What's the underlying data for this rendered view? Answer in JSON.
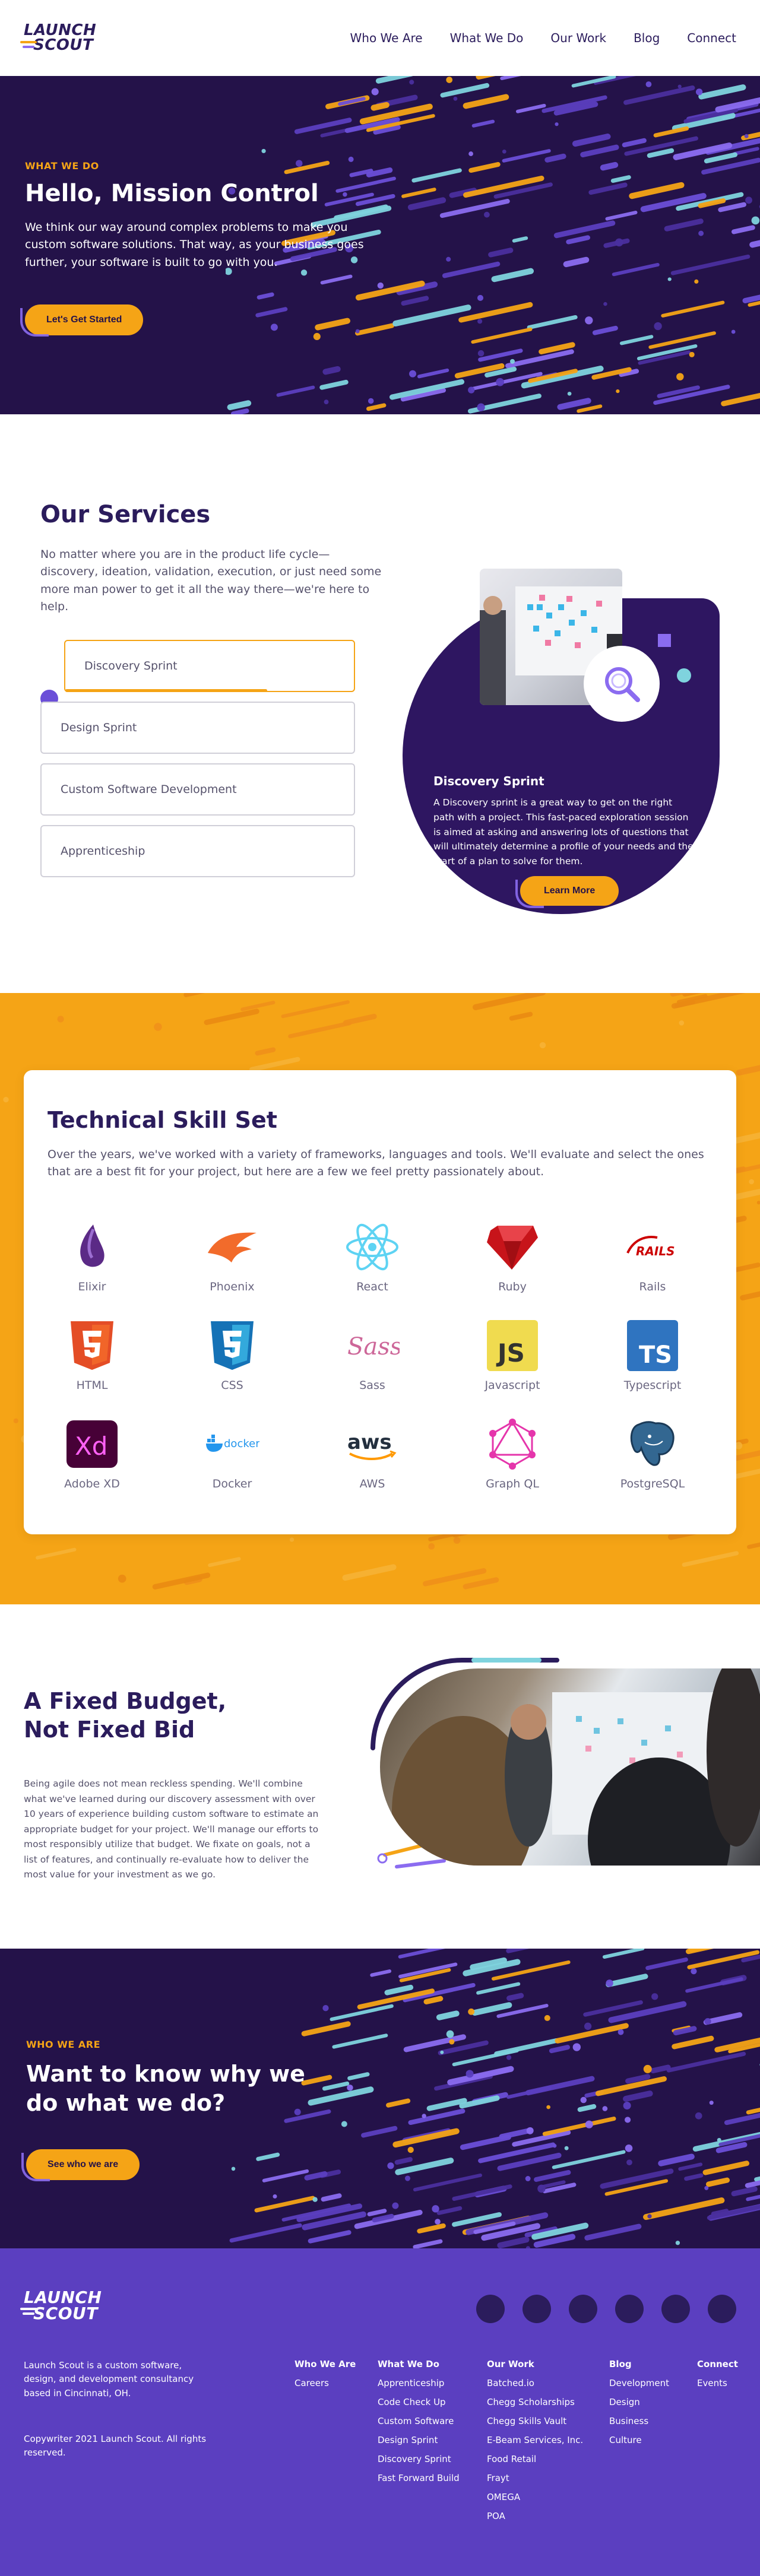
{
  "nav": {
    "logo_line1": "LAUNCH",
    "logo_line2": "SCOUT",
    "links": [
      "Who We Are",
      "What We Do",
      "Our Work",
      "Blog",
      "Connect"
    ]
  },
  "hero": {
    "eyebrow": "WHAT WE DO",
    "title": "Hello, Mission Control",
    "body": "We think our way around complex problems to make you custom software solutions. That way, as your business goes further, your software is built to go with you.",
    "cta": "Let's Get Started"
  },
  "services": {
    "title": "Our Services",
    "lead": "No matter where you are in the product life cycle—discovery, ideation, validation, execution, or just need some more man power to get it all the way there—we're here to help.",
    "items": [
      "Discovery Sprint",
      "Design Sprint",
      "Custom Software Development",
      "Apprenticeship"
    ],
    "active_index": 0,
    "card": {
      "title": "Discovery Sprint",
      "body": "A Discovery sprint is a great way to get on the right path with a project. This fast-paced exploration session is aimed at asking and answering lots of questions that will ultimately determine a profile of your needs and the start of a plan to solve for them.",
      "cta": "Learn More"
    }
  },
  "skills": {
    "title": "Technical Skill Set",
    "lead": "Over the years, we've worked with a variety of frameworks, languages and tools. We'll evaluate and select the ones that are a best fit for your project, but here are a few we feel pretty passionately about.",
    "items": [
      {
        "name": "Elixir",
        "icon": "elixir-icon"
      },
      {
        "name": "Phoenix",
        "icon": "phoenix-icon"
      },
      {
        "name": "React",
        "icon": "react-icon"
      },
      {
        "name": "Ruby",
        "icon": "ruby-icon"
      },
      {
        "name": "Rails",
        "icon": "rails-icon"
      },
      {
        "name": "HTML",
        "icon": "html5-icon"
      },
      {
        "name": "CSS",
        "icon": "css3-icon"
      },
      {
        "name": "Sass",
        "icon": "sass-icon"
      },
      {
        "name": "Javascript",
        "icon": "javascript-icon"
      },
      {
        "name": "Typescript",
        "icon": "typescript-icon"
      },
      {
        "name": "Adobe XD",
        "icon": "adobe-xd-icon"
      },
      {
        "name": "Docker",
        "icon": "docker-icon"
      },
      {
        "name": "AWS",
        "icon": "aws-icon"
      },
      {
        "name": "Graph QL",
        "icon": "graphql-icon"
      },
      {
        "name": "PostgreSQL",
        "icon": "postgresql-icon"
      }
    ],
    "icon_text": {
      "rails": "RAILS",
      "js": "JS",
      "ts": "TS",
      "xd": "Xd",
      "docker": "docker",
      "aws": "aws",
      "sass": "Sass"
    }
  },
  "budget": {
    "title": "A Fixed Budget, Not Fixed Bid",
    "body": "Being agile does not mean reckless spending. We'll combine what we've learned during our discovery assessment with over 10 years of experience building custom software to estimate an appropriate budget for your project. We'll manage our efforts to most responsibly utilize that budget. We fixate on goals, not a list of features, and continually re-evaluate how to deliver the most value for your investment as we go."
  },
  "who": {
    "eyebrow": "WHO WE ARE",
    "title": "Want to know why we do what we do?",
    "cta": "See who we are"
  },
  "footer": {
    "about": "Launch Scout is a custom software, design, and development consultancy based in Cincinnati, OH.",
    "copyright": "Copywriter 2021 Launch Scout. All rights reserved.",
    "columns": [
      {
        "heading": "Who We Are",
        "links": [
          "Careers"
        ]
      },
      {
        "heading": "What We Do",
        "links": [
          "Apprenticeship",
          "Code Check Up",
          "Custom Software",
          "Design Sprint",
          "Discovery Sprint",
          "Fast Forward Build"
        ]
      },
      {
        "heading": "Our Work",
        "links": [
          "Batched.io",
          "Chegg Scholarships",
          "Chegg Skills Vault",
          "E-Beam Services, Inc.",
          "Food Retail",
          "Frayt",
          "OMEGA",
          "POA"
        ]
      },
      {
        "heading": "Blog",
        "links": [
          "Development",
          "Design",
          "Business",
          "Culture"
        ]
      },
      {
        "heading": "Connect",
        "links": [
          "Events"
        ]
      }
    ],
    "socials": [
      "social-icon-1",
      "social-icon-2",
      "social-icon-3",
      "social-icon-4",
      "social-icon-5",
      "social-icon-6"
    ]
  },
  "colors": {
    "navy": "#241249",
    "purple": "#5b3fc0",
    "orange": "#f5a416",
    "lavender": "#8b6cf0",
    "teal": "#7fd3de"
  }
}
